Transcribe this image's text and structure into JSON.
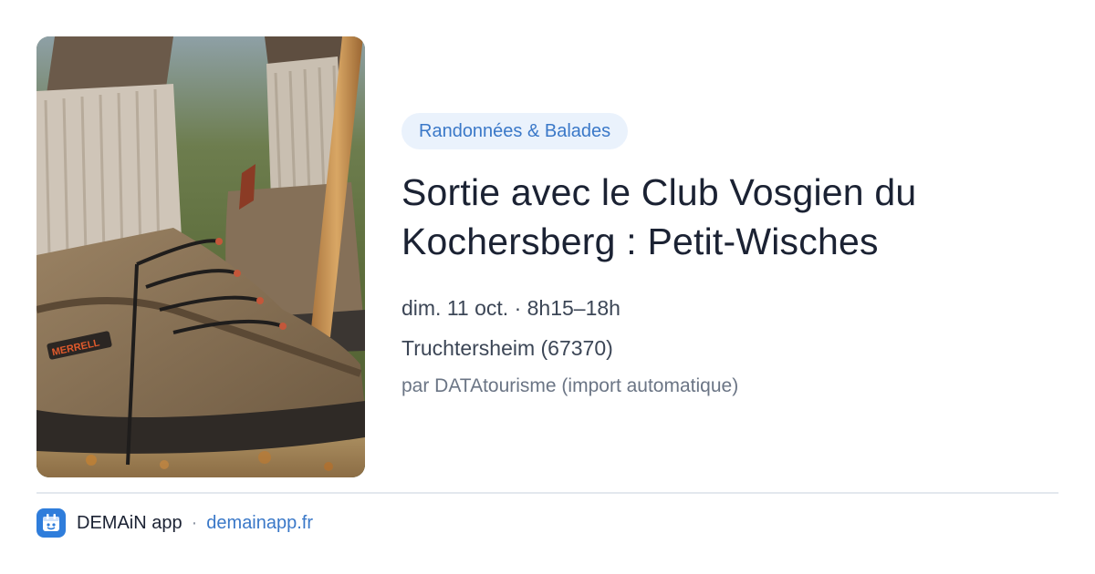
{
  "card": {
    "image_alt": "hiking-boots-photo",
    "category": "Randonnées & Balades",
    "title": "Sortie avec le Club Vosgien du Kochersberg : Petit-Wisches",
    "datetime": "dim. 11 oct. · 8h15–18h",
    "location": "Truchtersheim (67370)",
    "source": "par DATAtourisme (import automatique)",
    "boot_brand": "MERRELL"
  },
  "footer": {
    "app_icon": "calendar-icon",
    "app_name": "DEMAiN app",
    "separator": "·",
    "link": "demainapp.fr"
  },
  "colors": {
    "chip_bg": "#eaf2fc",
    "chip_text": "#3a78c8",
    "title": "#1b2233",
    "link": "#3a78c8",
    "app_icon_bg": "#2f7ddb"
  }
}
